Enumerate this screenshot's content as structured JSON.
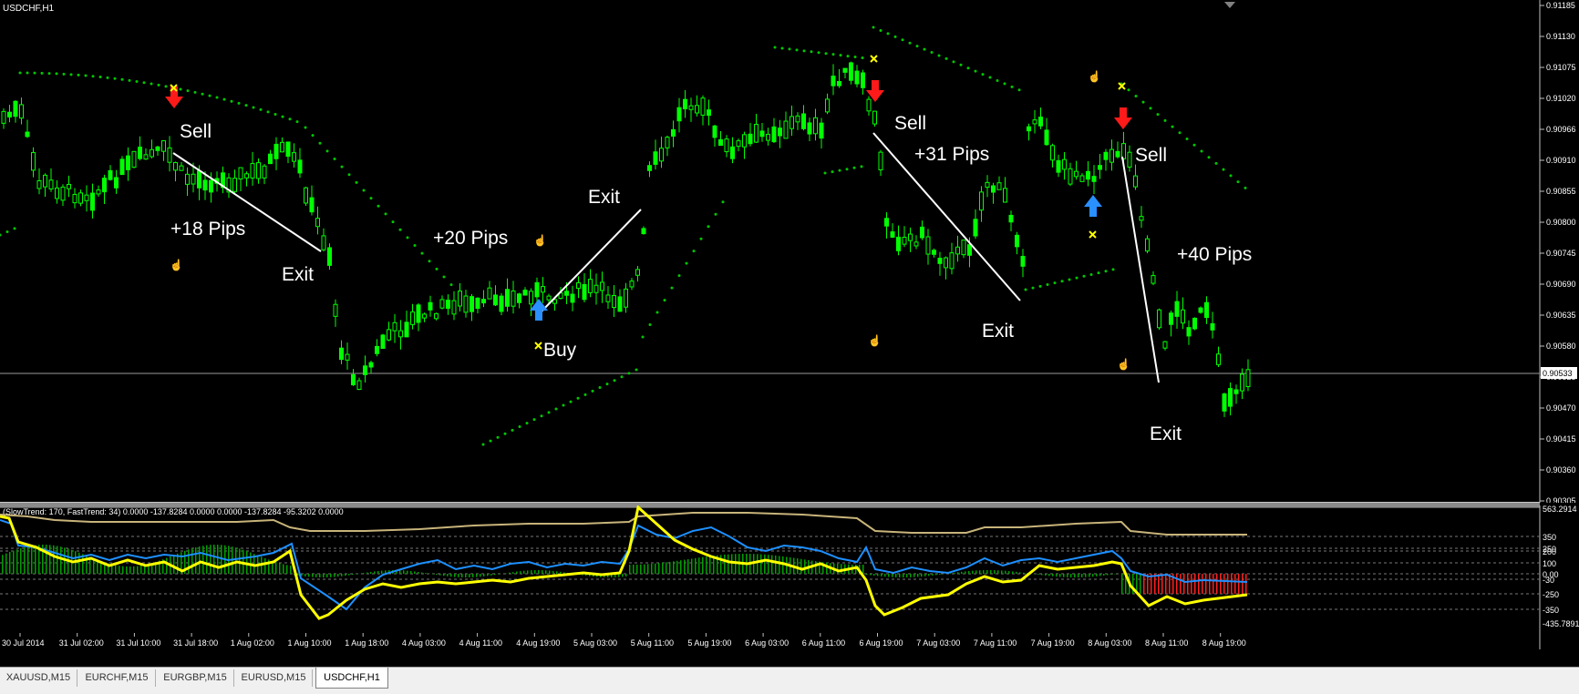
{
  "window": {
    "title": "USDCHF,H1"
  },
  "main_chart": {
    "price_axis": [
      "0.91185",
      "0.91130",
      "0.91075",
      "0.91020",
      "0.90966",
      "0.90910",
      "0.90855",
      "0.90800",
      "0.90745",
      "0.90690",
      "0.90635",
      "0.90580",
      "0.90525",
      "0.90470",
      "0.90415",
      "0.90360",
      "0.90305"
    ],
    "current_price": "0.90533",
    "annotations": {
      "sell_1": "Sell",
      "pips_1": "+18 Pips",
      "exit_1": "Exit",
      "pips_2": "+20 Pips",
      "exit_2": "Exit",
      "buy_1": "Buy",
      "sell_2": "Sell",
      "pips_3": "+31 Pips",
      "exit_3": "Exit",
      "sell_3": "Sell",
      "pips_4": "+40 Pips",
      "exit_4": "Exit"
    },
    "colors": {
      "bull_candle": "#00ff00",
      "bear_wick": "#00ff00",
      "sar_dots": "#00c800",
      "sell_arrow": "#ff1a1a",
      "buy_arrow": "#2a8fff",
      "marker": "#ffff00",
      "trend_line": "#ffffff"
    },
    "icons": [
      "sell-arrow-icon",
      "buy-arrow-icon",
      "x-marker-icon",
      "hand-marker-icon"
    ]
  },
  "indicator": {
    "header": "(SlowTrend: 170, FastTrend: 34)  0.0000 -137.8284 0.0000 0.0000 -137.8284 -95.3202 0.0000",
    "axis": [
      "563.2914",
      "350",
      "250",
      "200",
      "100",
      "0.00",
      "-30",
      "-250",
      "-350",
      "-435.7891"
    ],
    "colors": {
      "fast": "#ffff00",
      "slow": "#1e90ff",
      "tan": "#c8b47a",
      "hist_pos": "#00a000",
      "hist_neg": "#ff2020"
    }
  },
  "time_axis": [
    "30 Jul 2014",
    "31 Jul 02:00",
    "31 Jul 10:00",
    "31 Jul 18:00",
    "1 Aug 02:00",
    "1 Aug 10:00",
    "1 Aug 18:00",
    "4 Aug 03:00",
    "4 Aug 11:00",
    "4 Aug 19:00",
    "5 Aug 03:00",
    "5 Aug 11:00",
    "5 Aug 19:00",
    "6 Aug 03:00",
    "6 Aug 11:00",
    "6 Aug 19:00",
    "7 Aug 03:00",
    "7 Aug 11:00",
    "7 Aug 19:00",
    "8 Aug 03:00",
    "8 Aug 11:00",
    "8 Aug 19:00"
  ],
  "tabs": [
    "XAUUSD,M15",
    "EURCHF,M15",
    "EURGBP,M15",
    "EURUSD,M15",
    "USDCHF,H1"
  ],
  "active_tab": "USDCHF,H1"
}
